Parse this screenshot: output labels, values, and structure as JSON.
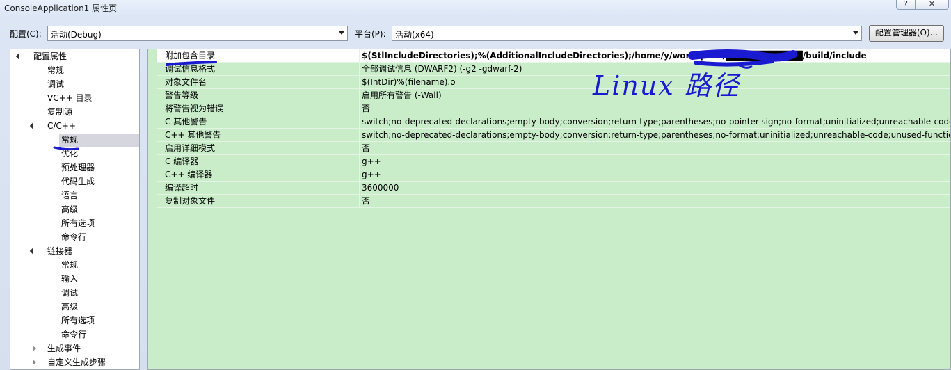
{
  "window": {
    "title": "ConsoleApplication1 属性页",
    "help_label": "?",
    "close_label": "✕"
  },
  "toolbar": {
    "config_label": "配置(C):",
    "config_value": "活动(Debug)",
    "platform_label": "平台(P):",
    "platform_value": "活动(x64)",
    "config_manager_label": "配置管理器(O)..."
  },
  "tree": {
    "items": [
      {
        "label": "配置属性",
        "level": 0,
        "expander": "down"
      },
      {
        "label": "常规",
        "level": 1,
        "expander": ""
      },
      {
        "label": "调试",
        "level": 1,
        "expander": ""
      },
      {
        "label": "VC++ 目录",
        "level": 1,
        "expander": ""
      },
      {
        "label": "复制源",
        "level": 1,
        "expander": ""
      },
      {
        "label": "C/C++",
        "level": 1,
        "expander": "down"
      },
      {
        "label": "常规",
        "level": 2,
        "expander": "",
        "selected": true
      },
      {
        "label": "优化",
        "level": 2,
        "expander": ""
      },
      {
        "label": "预处理器",
        "level": 2,
        "expander": ""
      },
      {
        "label": "代码生成",
        "level": 2,
        "expander": ""
      },
      {
        "label": "语言",
        "level": 2,
        "expander": ""
      },
      {
        "label": "高级",
        "level": 2,
        "expander": ""
      },
      {
        "label": "所有选项",
        "level": 2,
        "expander": ""
      },
      {
        "label": "命令行",
        "level": 2,
        "expander": ""
      },
      {
        "label": "链接器",
        "level": 1,
        "expander": "down"
      },
      {
        "label": "常规",
        "level": 2,
        "expander": ""
      },
      {
        "label": "输入",
        "level": 2,
        "expander": ""
      },
      {
        "label": "调试",
        "level": 2,
        "expander": ""
      },
      {
        "label": "高级",
        "level": 2,
        "expander": ""
      },
      {
        "label": "所有选项",
        "level": 2,
        "expander": ""
      },
      {
        "label": "命令行",
        "level": 2,
        "expander": ""
      },
      {
        "label": "生成事件",
        "level": 1,
        "expander": "right"
      },
      {
        "label": "自定义生成步骤",
        "level": 1,
        "expander": "right"
      }
    ]
  },
  "properties": {
    "rows": [
      {
        "name": "附加包含目录",
        "value": "$(StlIncludeDirectories);%(AdditionalIncludeDirectories);/home/y/workspace/████████████/build/include"
      },
      {
        "name": "调试信息格式",
        "value": "全部调试信息 (DWARF2) (-g2 -gdwarf-2)"
      },
      {
        "name": "对象文件名",
        "value": "$(IntDir)%(filename).o"
      },
      {
        "name": "警告等级",
        "value": "启用所有警告 (-Wall)"
      },
      {
        "name": "将警告视为错误",
        "value": "否"
      },
      {
        "name": "C 其他警告",
        "value": "switch;no-deprecated-declarations;empty-body;conversion;return-type;parentheses;no-pointer-sign;no-format;uninitialized;unreachable-code;unu"
      },
      {
        "name": "C++ 其他警告",
        "value": "switch;no-deprecated-declarations;empty-body;conversion;return-type;parentheses;no-format;uninitialized;unreachable-code;unused-function;unu"
      },
      {
        "name": "启用详细模式",
        "value": "否"
      },
      {
        "name": "C 编译器",
        "value": "g++"
      },
      {
        "name": "C++ 编译器",
        "value": "g++"
      },
      {
        "name": "编译超时",
        "value": "3600000"
      },
      {
        "name": "复制对象文件",
        "value": "否"
      }
    ]
  },
  "annotation": {
    "text": "Linux 路径",
    "color": "#1a1ad0"
  }
}
